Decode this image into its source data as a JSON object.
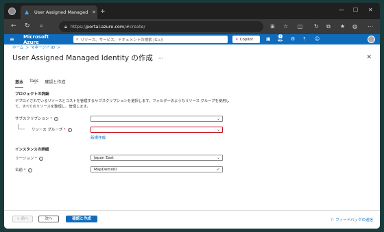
{
  "browser": {
    "tab_title": "User Assigned Managed Identity",
    "url_prefix": "https://",
    "url_host": "portal.azure.com",
    "url_path": "/#create/"
  },
  "azure": {
    "brand": "Microsoft Azure",
    "search_placeholder": "リソース、サービス、ドキュメントの検索 (G+/)",
    "copilot_label": "Copilot",
    "notification_count": "2"
  },
  "breadcrumb": [
    "ホーム",
    "マネージド ID"
  ],
  "page": {
    "title": "User Assigned Managed Identity の作成",
    "more": "···"
  },
  "tabs": [
    "基本",
    "Tags",
    "確認と作成"
  ],
  "project": {
    "heading": "プロジェクトの詳細",
    "description": "デプロイされているリソースとコストを管理するサブスクリプションを選択します。フォルダーのようなリソース グループを使用して、すべてのリソースを整理し、管理します。",
    "subscription_label": "サブスクリプション",
    "subscription_value": "",
    "resource_group_label": "リソース グループ",
    "resource_group_value": "",
    "new_link": "新規作成"
  },
  "instance": {
    "heading": "インスタンスの詳細",
    "region_label": "リージョン",
    "region_value": "Japan East",
    "name_label": "名前",
    "name_value": "MapDemoID"
  },
  "footer": {
    "prev": "< 前へ",
    "next": "次へ",
    "create": "確認と作成",
    "feedback": "フィードバックの送信"
  }
}
